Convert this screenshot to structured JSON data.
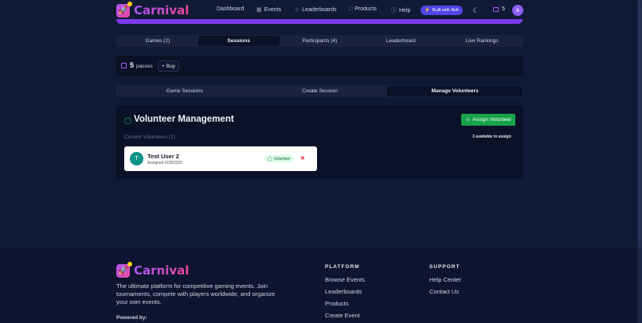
{
  "header": {
    "brand": "Carnival",
    "nav": [
      "Dashboard",
      "Events",
      "Leaderboards",
      "Products",
      "Help"
    ],
    "bolt_badge": "Built with Bolt",
    "pass_count": "5",
    "avatar_initial": "A",
    "accent": "#7c3aed"
  },
  "main_tabs": [
    "Games (2)",
    "Sessions",
    "Participants (4)",
    "Leaderboard",
    "Live Rankings"
  ],
  "passes": {
    "count": "5",
    "label": "passes",
    "buy": "Buy"
  },
  "sub_tabs": [
    "Game Sessions",
    "Create Session",
    "Manage Volunteers"
  ],
  "volunteers": {
    "title": "Volunteer Management",
    "assign_button": "Assign Volunteer",
    "current_label": "Current Volunteers (1)",
    "available_label": "3 available to assign",
    "list": [
      {
        "initial": "T",
        "name": "Test User 2",
        "assigned": "Assigned 6/28/2025",
        "role": "Volunteer"
      }
    ]
  },
  "footer": {
    "brand": "Carnival",
    "description": "The ultimate platform for competitive gaming events. Join tournaments, compete with players worldwide, and organize your own events.",
    "powered_by": "Powered by:",
    "platform_heading": "PLATFORM",
    "platform_links": [
      "Browse Events",
      "Leaderboards",
      "Products",
      "Create Event"
    ],
    "support_heading": "SUPPORT",
    "support_links": [
      "Help Center",
      "Contact Us"
    ]
  }
}
